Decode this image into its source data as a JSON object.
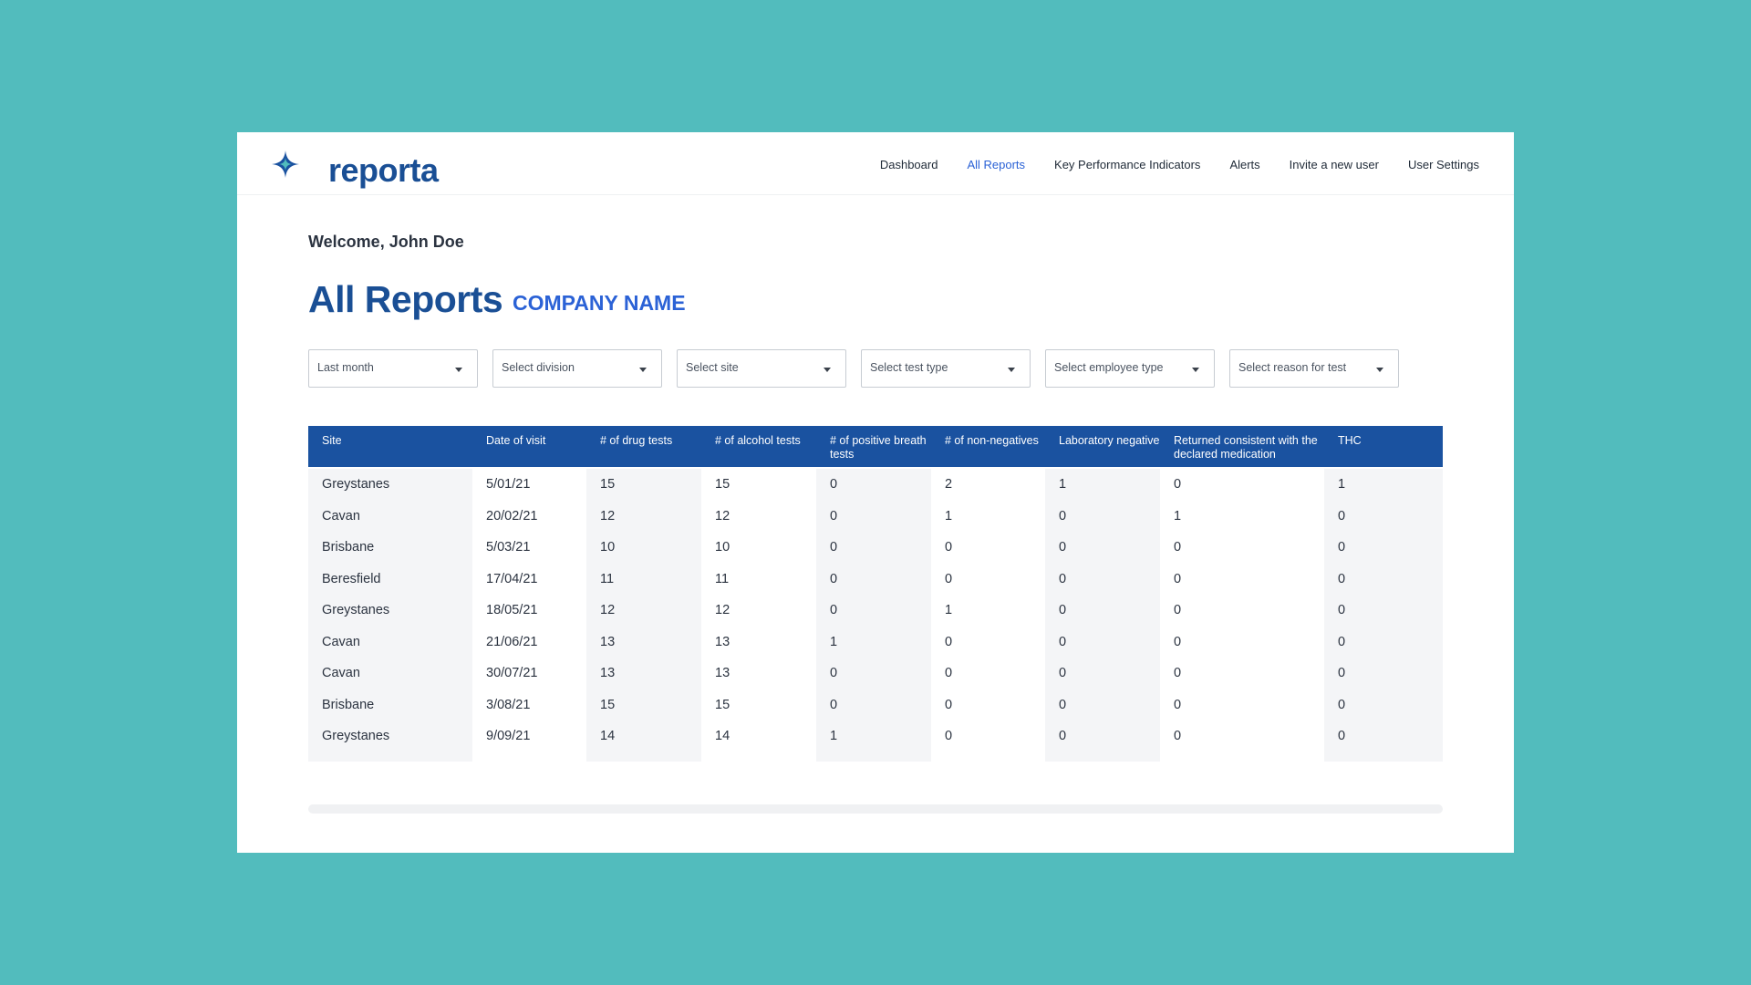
{
  "brand": {
    "name": "reporta",
    "accent": "#1a4f95",
    "mark_color": "#52bcbd"
  },
  "nav": {
    "items": [
      {
        "label": "Dashboard",
        "active": false
      },
      {
        "label": "All Reports",
        "active": true
      },
      {
        "label": "Key Performance Indicators",
        "active": false
      },
      {
        "label": "Alerts",
        "active": false
      },
      {
        "label": "Invite a new user",
        "active": false
      },
      {
        "label": "User Settings",
        "active": false
      }
    ]
  },
  "welcome": "Welcome, John Doe",
  "page": {
    "title": "All Reports",
    "company": "COMPANY NAME"
  },
  "filters": [
    {
      "value": "Last month"
    },
    {
      "placeholder": "Select division"
    },
    {
      "placeholder": "Select site"
    },
    {
      "placeholder": "Select test type"
    },
    {
      "placeholder": "Select employee type"
    },
    {
      "placeholder": "Select reason for test"
    }
  ],
  "table": {
    "headers": [
      "Site",
      "Date of visit",
      "# of drug tests",
      "# of alcohol tests",
      "# of positive breath tests",
      "# of non-negatives",
      "Laboratory negative",
      "Returned consistent with the declared medication",
      "THC"
    ],
    "rows": [
      [
        "Greystanes",
        "5/01/21",
        "15",
        "15",
        "0",
        "2",
        "1",
        "0",
        "1"
      ],
      [
        "Cavan",
        "20/02/21",
        "12",
        "12",
        "0",
        "1",
        "0",
        "1",
        "0"
      ],
      [
        "Brisbane",
        "5/03/21",
        "10",
        "10",
        "0",
        "0",
        "0",
        "0",
        "0"
      ],
      [
        "Beresfield",
        "17/04/21",
        "11",
        "11",
        "0",
        "0",
        "0",
        "0",
        "0"
      ],
      [
        "Greystanes",
        "18/05/21",
        "12",
        "12",
        "0",
        "1",
        "0",
        "0",
        "0"
      ],
      [
        "Cavan",
        "21/06/21",
        "13",
        "13",
        "1",
        "0",
        "0",
        "0",
        "0"
      ],
      [
        "Cavan",
        "30/07/21",
        "13",
        "13",
        "0",
        "0",
        "0",
        "0",
        "0"
      ],
      [
        "Brisbane",
        "3/08/21",
        "15",
        "15",
        "0",
        "0",
        "0",
        "0",
        "0"
      ],
      [
        "Greystanes",
        "9/09/21",
        "14",
        "14",
        "1",
        "0",
        "0",
        "0",
        "0"
      ]
    ]
  }
}
